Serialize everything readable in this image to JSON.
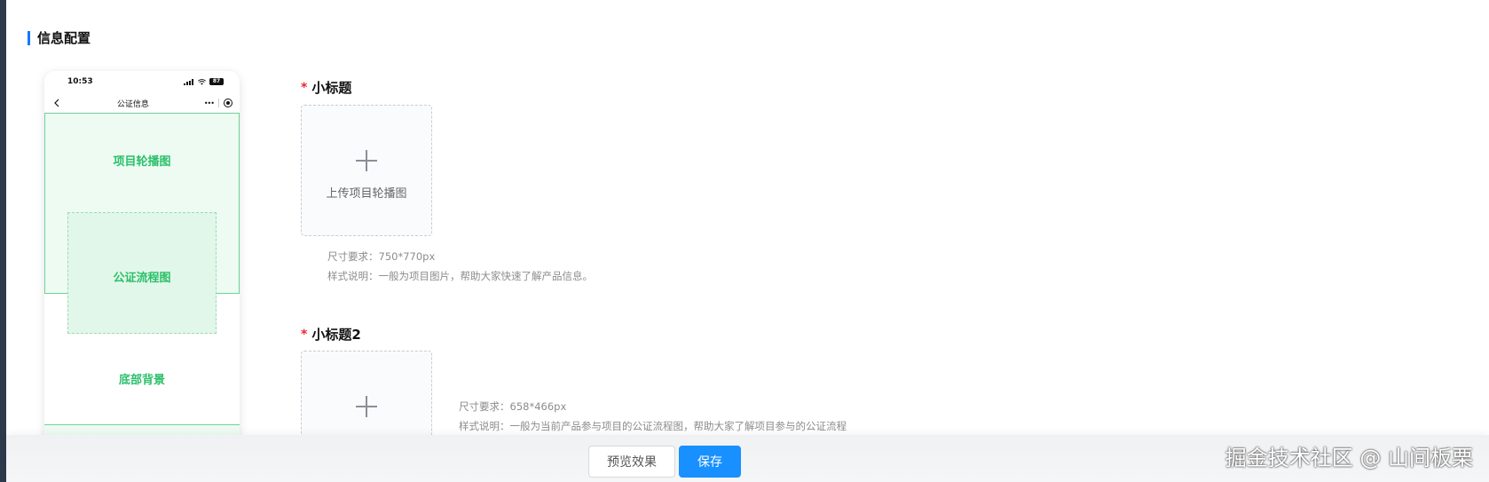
{
  "section": {
    "title": "信息配置"
  },
  "phone": {
    "time": "10:53",
    "battery": "87",
    "nav_title": "公证信息",
    "zones": {
      "banner": "项目轮播图",
      "flow": "公证流程图",
      "bottom": "底部背景"
    }
  },
  "fields": [
    {
      "label": "小标题",
      "upload_text": "上传项目轮播图",
      "size_hint": "尺寸要求：750*770px",
      "style_hint": "样式说明：一般为项目图片，帮助大家快速了解产品信息。"
    },
    {
      "label": "小标题2",
      "size_hint": "尺寸要求：658*466px",
      "style_hint": "样式说明：一般为当前产品参与项目的公证流程图，帮助大家了解项目参与的公证流程"
    }
  ],
  "footer": {
    "preview_label": "预览效果",
    "save_label": "保存"
  },
  "watermark": "掘金技术社区 @ 山间板栗",
  "colors": {
    "accent": "#1890ff",
    "zone_green": "#2bbf6a",
    "required": "#f5222d"
  }
}
